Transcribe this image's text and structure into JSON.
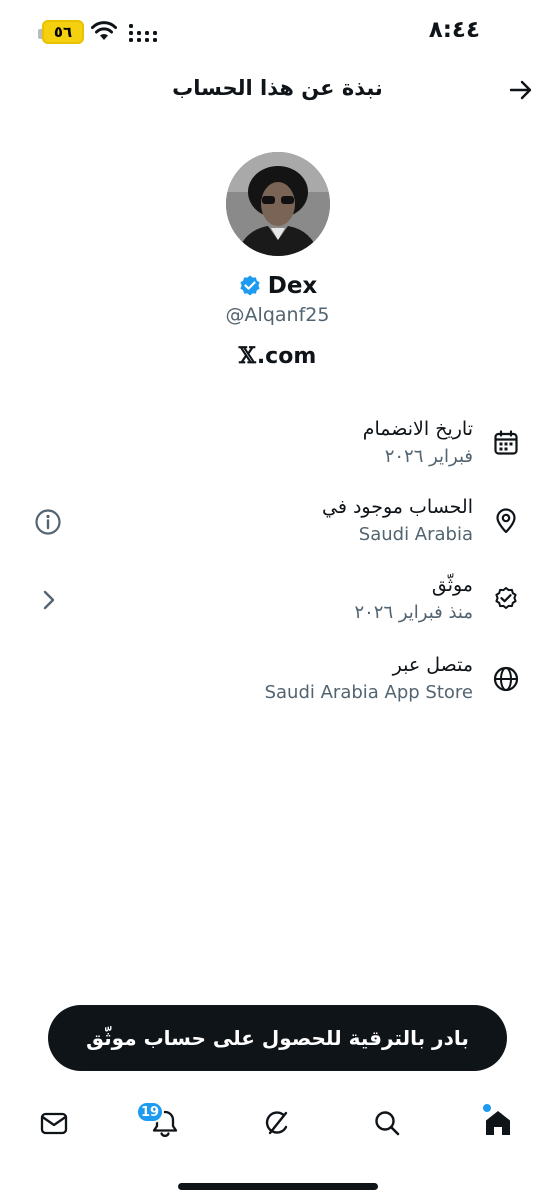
{
  "status_bar": {
    "time": "٨:٤٤",
    "battery": "٥٦",
    "battery_color": "#f5d00f"
  },
  "header": {
    "title": "نبذة عن هذا الحساب",
    "back_icon": "arrow-back-icon"
  },
  "profile": {
    "display_name": "Dex",
    "verified_icon": "verified-badge-icon",
    "verified_color": "#1d9bf0",
    "handle": "@Alqanf25",
    "x_logo": "𝕏",
    "website_suffix": ".com"
  },
  "info_rows": [
    {
      "icon": "calendar-icon",
      "title": "تاريخ الانضمام",
      "value": "فبراير ٢٠٢٦"
    },
    {
      "icon": "location-pin-icon",
      "title": "الحساب موجود في",
      "value": "Saudi Arabia",
      "aside_icon": "info-icon"
    },
    {
      "icon": "verified-check-icon",
      "title": "موثّق",
      "value": "منذ فبراير ٢٠٢٦",
      "aside_icon": "chevron-icon"
    },
    {
      "icon": "globe-icon",
      "title": "متصل عبر",
      "value": "Saudi Arabia App Store"
    }
  ],
  "upgrade_button": {
    "label": "بادر بالترقية للحصول على حساب موثّق"
  },
  "bottom_nav": {
    "items": [
      "messages-icon",
      "notifications-icon",
      "grok-icon",
      "search-icon",
      "home-icon"
    ],
    "notifications_badge": "19",
    "accent_color": "#1d9bf0"
  }
}
